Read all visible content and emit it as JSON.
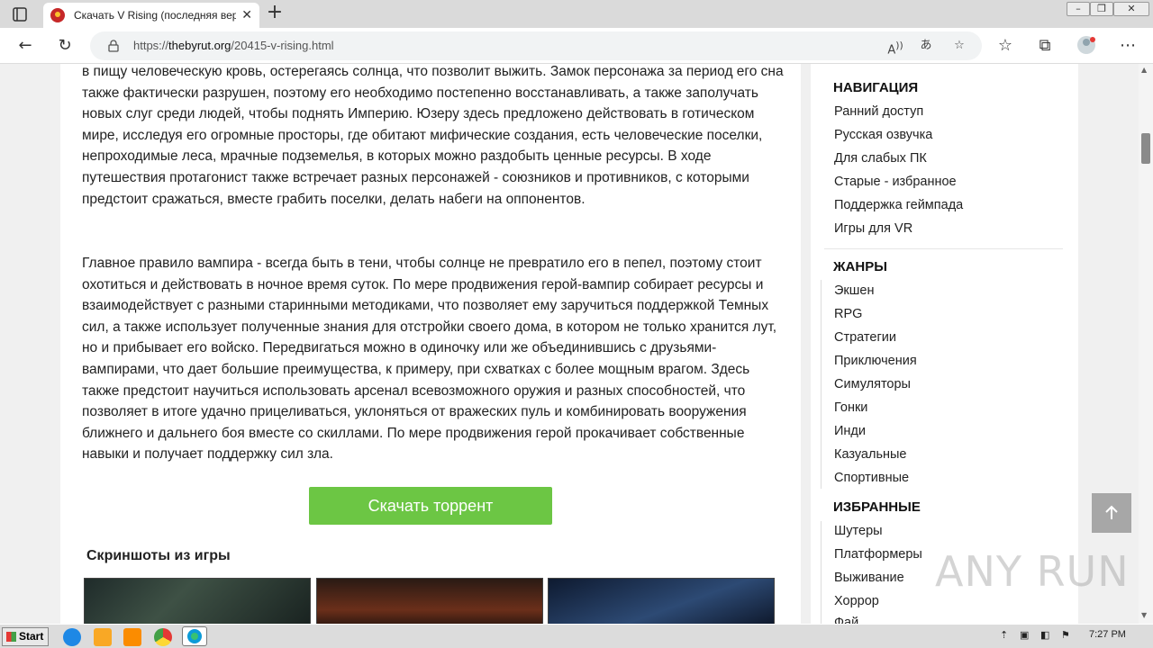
{
  "browser": {
    "tab_title": "Скачать V Rising (последняя вер",
    "url_scheme": "https://",
    "url_host": "thebyrut.org",
    "url_path": "/20415-v-rising.html"
  },
  "article": {
    "paragraph1": "в пищу человеческую кровь, остерегаясь солнца, что позволит выжить. Замок персонажа за период его сна также фактически разрушен, поэтому его необходимо постепенно восстанавливать, а также заполучать новых слуг среди людей, чтобы поднять Империю. Юзеру здесь предложено действовать в готическом мире, исследуя его огромные просторы, где обитают мифические создания, есть человеческие поселки, непроходимые леса, мрачные подземелья, в которых можно раздобыть ценные ресурсы. В ходе путешествия протагонист также встречает разных персонажей - союзников и противников, с которыми предстоит сражаться, вместе грабить поселки, делать набеги на оппонентов.",
    "paragraph2": "Главное правило вампира - всегда быть в тени, чтобы солнце не превратило его в пепел, поэтому стоит охотиться и действовать в ночное время суток. По мере продвижения герой-вампир собирает ресурсы и взаимодействует с разными старинными методиками, что позволяет ему заручиться поддержкой Темных сил, а также использует полученные знания для отстройки своего дома, в котором не только хранится лут, но и прибывает его войско. Передвигаться можно в одиночку или же объединившись с друзьями-вампирами, что дает большие преимущества, к примеру, при схватках с более мощным врагом. Здесь также предстоит научиться использовать арсенал всевозможного оружия и разных способностей, что позволяет в итоге удачно прицеливаться, уклоняться от вражеских пуль и комбинировать вооружения ближнего и дальнего боя вместе со скиллами. По мере продвижения герой прокачивает собственные навыки и получает поддержку сил зла.",
    "download_label": "Скачать торрент",
    "screenshots_title": "Скриншоты из игры"
  },
  "sidebar": {
    "nav_title": "НАВИГАЦИЯ",
    "nav_items": [
      "Ранний доступ",
      "Русская озвучка",
      "Для слабых ПК",
      "Старые - избранное",
      "Поддержка геймпада",
      "Игры для VR"
    ],
    "genres_title": "ЖАНРЫ",
    "genre_items": [
      "Экшен",
      "RPG",
      "Стратегии",
      "Приключения",
      "Симуляторы",
      "Гонки",
      "Инди",
      "Казуальные",
      "Спортивные"
    ],
    "fav_title": "ИЗБРАННЫЕ",
    "fav_items": [
      "Шутеры",
      "Платформеры",
      "Выживание",
      "Хоррор",
      "Фай"
    ]
  },
  "overlay": {
    "scroll_top_icon": "arrow-up-icon",
    "watermark": "ANY RUN"
  },
  "taskbar": {
    "start_label": "Start",
    "clock": "7:27 PM"
  }
}
